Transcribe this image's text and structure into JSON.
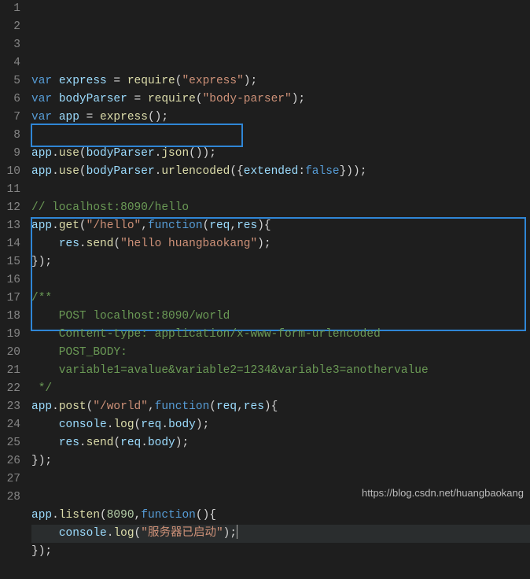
{
  "watermark": "https://blog.csdn.net/huangbaokang",
  "lines": [
    {
      "n": 1,
      "segments": [
        [
          "kw",
          "var"
        ],
        [
          "pl",
          " "
        ],
        [
          "ident",
          "express"
        ],
        [
          "pl",
          " = "
        ],
        [
          "fn",
          "require"
        ],
        [
          "pl",
          "("
        ],
        [
          "str",
          "\"express\""
        ],
        [
          "pl",
          ");"
        ]
      ]
    },
    {
      "n": 2,
      "segments": [
        [
          "kw",
          "var"
        ],
        [
          "pl",
          " "
        ],
        [
          "ident",
          "bodyParser"
        ],
        [
          "pl",
          " = "
        ],
        [
          "fn",
          "require"
        ],
        [
          "pl",
          "("
        ],
        [
          "str",
          "\"body-parser\""
        ],
        [
          "pl",
          ");"
        ]
      ]
    },
    {
      "n": 3,
      "segments": [
        [
          "kw",
          "var"
        ],
        [
          "pl",
          " "
        ],
        [
          "ident",
          "app"
        ],
        [
          "pl",
          " = "
        ],
        [
          "fn",
          "express"
        ],
        [
          "pl",
          "();"
        ]
      ]
    },
    {
      "n": 4,
      "segments": []
    },
    {
      "n": 5,
      "segments": [
        [
          "ident",
          "app"
        ],
        [
          "pl",
          "."
        ],
        [
          "fn",
          "use"
        ],
        [
          "pl",
          "("
        ],
        [
          "ident",
          "bodyParser"
        ],
        [
          "pl",
          "."
        ],
        [
          "fn",
          "json"
        ],
        [
          "pl",
          "());"
        ]
      ]
    },
    {
      "n": 6,
      "segments": [
        [
          "ident",
          "app"
        ],
        [
          "pl",
          "."
        ],
        [
          "fn",
          "use"
        ],
        [
          "pl",
          "("
        ],
        [
          "ident",
          "bodyParser"
        ],
        [
          "pl",
          "."
        ],
        [
          "fn",
          "urlencoded"
        ],
        [
          "pl",
          "({"
        ],
        [
          "ident",
          "extended"
        ],
        [
          "pl",
          ":"
        ],
        [
          "kw",
          "false"
        ],
        [
          "pl",
          "}));"
        ]
      ]
    },
    {
      "n": 7,
      "segments": []
    },
    {
      "n": 8,
      "segments": [
        [
          "cmt",
          "// localhost:8090/hello"
        ]
      ]
    },
    {
      "n": 9,
      "segments": [
        [
          "ident",
          "app"
        ],
        [
          "pl",
          "."
        ],
        [
          "fn",
          "get"
        ],
        [
          "pl",
          "("
        ],
        [
          "str",
          "\"/hello\""
        ],
        [
          "pl",
          ","
        ],
        [
          "kw",
          "function"
        ],
        [
          "pl",
          "("
        ],
        [
          "ident",
          "req"
        ],
        [
          "pl",
          ","
        ],
        [
          "ident",
          "res"
        ],
        [
          "pl",
          "){"
        ]
      ]
    },
    {
      "n": 10,
      "segments": [
        [
          "pl",
          "    "
        ],
        [
          "ident",
          "res"
        ],
        [
          "pl",
          "."
        ],
        [
          "fn",
          "send"
        ],
        [
          "pl",
          "("
        ],
        [
          "str",
          "\"hello huangbaokang\""
        ],
        [
          "pl",
          ");"
        ]
      ]
    },
    {
      "n": 11,
      "segments": [
        [
          "pl",
          "});"
        ]
      ]
    },
    {
      "n": 12,
      "segments": []
    },
    {
      "n": 13,
      "segments": [
        [
          "cmt",
          "/**"
        ]
      ]
    },
    {
      "n": 14,
      "segments": [
        [
          "cmt",
          "    POST localhost:8090/world"
        ]
      ]
    },
    {
      "n": 15,
      "segments": [
        [
          "cmt",
          "    Content-type: application/x-www-form-urlencoded"
        ]
      ]
    },
    {
      "n": 16,
      "segments": [
        [
          "cmt",
          "    POST_BODY:"
        ]
      ]
    },
    {
      "n": 17,
      "segments": [
        [
          "cmt",
          "    variable1=avalue&variable2=1234&variable3=anothervalue"
        ]
      ]
    },
    {
      "n": 18,
      "segments": [
        [
          "cmt",
          " */"
        ]
      ]
    },
    {
      "n": 19,
      "segments": [
        [
          "ident",
          "app"
        ],
        [
          "pl",
          "."
        ],
        [
          "fn",
          "post"
        ],
        [
          "pl",
          "("
        ],
        [
          "str",
          "\"/world\""
        ],
        [
          "pl",
          ","
        ],
        [
          "kw",
          "function"
        ],
        [
          "pl",
          "("
        ],
        [
          "ident",
          "req"
        ],
        [
          "pl",
          ","
        ],
        [
          "ident",
          "res"
        ],
        [
          "pl",
          "){"
        ]
      ]
    },
    {
      "n": 20,
      "segments": [
        [
          "pl",
          "    "
        ],
        [
          "ident",
          "console"
        ],
        [
          "pl",
          "."
        ],
        [
          "fn",
          "log"
        ],
        [
          "pl",
          "("
        ],
        [
          "ident",
          "req"
        ],
        [
          "pl",
          "."
        ],
        [
          "ident",
          "body"
        ],
        [
          "pl",
          ");"
        ]
      ]
    },
    {
      "n": 21,
      "segments": [
        [
          "pl",
          "    "
        ],
        [
          "ident",
          "res"
        ],
        [
          "pl",
          "."
        ],
        [
          "fn",
          "send"
        ],
        [
          "pl",
          "("
        ],
        [
          "ident",
          "req"
        ],
        [
          "pl",
          "."
        ],
        [
          "ident",
          "body"
        ],
        [
          "pl",
          ");"
        ]
      ]
    },
    {
      "n": 22,
      "segments": [
        [
          "pl",
          "});"
        ]
      ]
    },
    {
      "n": 23,
      "segments": []
    },
    {
      "n": 24,
      "segments": []
    },
    {
      "n": 25,
      "segments": [
        [
          "ident",
          "app"
        ],
        [
          "pl",
          "."
        ],
        [
          "fn",
          "listen"
        ],
        [
          "pl",
          "("
        ],
        [
          "num",
          "8090"
        ],
        [
          "pl",
          ","
        ],
        [
          "kw",
          "function"
        ],
        [
          "pl",
          "(){"
        ]
      ]
    },
    {
      "n": 26,
      "highlight": true,
      "cursor": true,
      "segments": [
        [
          "pl",
          "    "
        ],
        [
          "ident",
          "console"
        ],
        [
          "pl",
          "."
        ],
        [
          "fn",
          "log"
        ],
        [
          "pl",
          "("
        ],
        [
          "str",
          "\"服务器已启动\""
        ],
        [
          "pl",
          ");"
        ]
      ]
    },
    {
      "n": 27,
      "segments": [
        [
          "pl",
          "});"
        ]
      ]
    },
    {
      "n": 28,
      "segments": []
    }
  ]
}
